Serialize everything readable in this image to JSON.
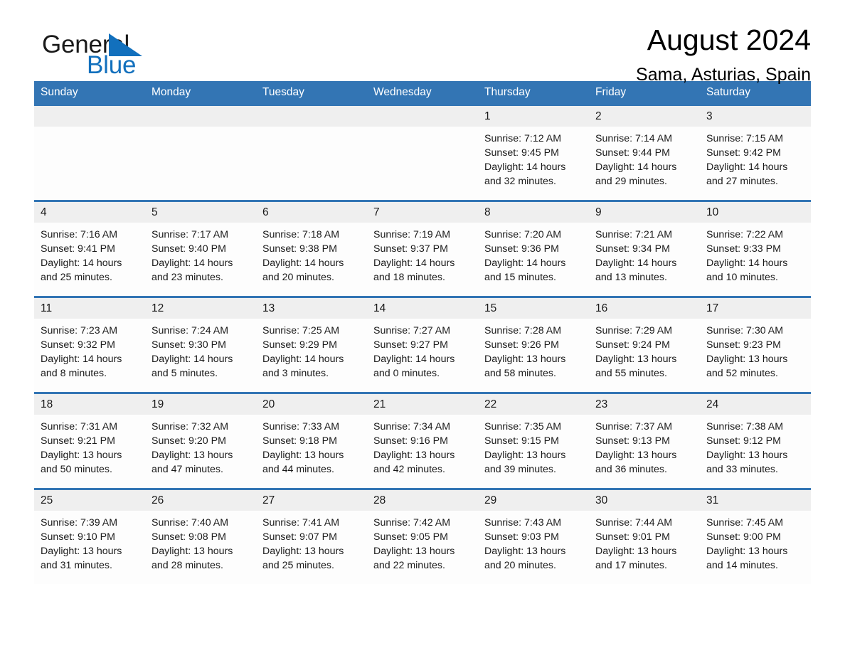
{
  "brand": {
    "name_part1": "General",
    "name_part2": "Blue",
    "flag_icon": "flag-triangle-icon",
    "accent_color": "#1270bd"
  },
  "header": {
    "title": "August 2024",
    "subtitle": "Sama, Asturias, Spain"
  },
  "calendar": {
    "header_bg": "#3375b4",
    "daynum_bg": "#efefef",
    "weekdays": [
      "Sunday",
      "Monday",
      "Tuesday",
      "Wednesday",
      "Thursday",
      "Friday",
      "Saturday"
    ],
    "labels": {
      "sunrise": "Sunrise:",
      "sunset": "Sunset:",
      "daylight": "Daylight:"
    },
    "weeks": [
      [
        {
          "day": "",
          "empty": true
        },
        {
          "day": "",
          "empty": true
        },
        {
          "day": "",
          "empty": true
        },
        {
          "day": "",
          "empty": true
        },
        {
          "day": "1",
          "sunrise": "Sunrise: 7:12 AM",
          "sunset": "Sunset: 9:45 PM",
          "daylight_1": "Daylight: 14 hours",
          "daylight_2": "and 32 minutes."
        },
        {
          "day": "2",
          "sunrise": "Sunrise: 7:14 AM",
          "sunset": "Sunset: 9:44 PM",
          "daylight_1": "Daylight: 14 hours",
          "daylight_2": "and 29 minutes."
        },
        {
          "day": "3",
          "sunrise": "Sunrise: 7:15 AM",
          "sunset": "Sunset: 9:42 PM",
          "daylight_1": "Daylight: 14 hours",
          "daylight_2": "and 27 minutes."
        }
      ],
      [
        {
          "day": "4",
          "sunrise": "Sunrise: 7:16 AM",
          "sunset": "Sunset: 9:41 PM",
          "daylight_1": "Daylight: 14 hours",
          "daylight_2": "and 25 minutes."
        },
        {
          "day": "5",
          "sunrise": "Sunrise: 7:17 AM",
          "sunset": "Sunset: 9:40 PM",
          "daylight_1": "Daylight: 14 hours",
          "daylight_2": "and 23 minutes."
        },
        {
          "day": "6",
          "sunrise": "Sunrise: 7:18 AM",
          "sunset": "Sunset: 9:38 PM",
          "daylight_1": "Daylight: 14 hours",
          "daylight_2": "and 20 minutes."
        },
        {
          "day": "7",
          "sunrise": "Sunrise: 7:19 AM",
          "sunset": "Sunset: 9:37 PM",
          "daylight_1": "Daylight: 14 hours",
          "daylight_2": "and 18 minutes."
        },
        {
          "day": "8",
          "sunrise": "Sunrise: 7:20 AM",
          "sunset": "Sunset: 9:36 PM",
          "daylight_1": "Daylight: 14 hours",
          "daylight_2": "and 15 minutes."
        },
        {
          "day": "9",
          "sunrise": "Sunrise: 7:21 AM",
          "sunset": "Sunset: 9:34 PM",
          "daylight_1": "Daylight: 14 hours",
          "daylight_2": "and 13 minutes."
        },
        {
          "day": "10",
          "sunrise": "Sunrise: 7:22 AM",
          "sunset": "Sunset: 9:33 PM",
          "daylight_1": "Daylight: 14 hours",
          "daylight_2": "and 10 minutes."
        }
      ],
      [
        {
          "day": "11",
          "sunrise": "Sunrise: 7:23 AM",
          "sunset": "Sunset: 9:32 PM",
          "daylight_1": "Daylight: 14 hours",
          "daylight_2": "and 8 minutes."
        },
        {
          "day": "12",
          "sunrise": "Sunrise: 7:24 AM",
          "sunset": "Sunset: 9:30 PM",
          "daylight_1": "Daylight: 14 hours",
          "daylight_2": "and 5 minutes."
        },
        {
          "day": "13",
          "sunrise": "Sunrise: 7:25 AM",
          "sunset": "Sunset: 9:29 PM",
          "daylight_1": "Daylight: 14 hours",
          "daylight_2": "and 3 minutes."
        },
        {
          "day": "14",
          "sunrise": "Sunrise: 7:27 AM",
          "sunset": "Sunset: 9:27 PM",
          "daylight_1": "Daylight: 14 hours",
          "daylight_2": "and 0 minutes."
        },
        {
          "day": "15",
          "sunrise": "Sunrise: 7:28 AM",
          "sunset": "Sunset: 9:26 PM",
          "daylight_1": "Daylight: 13 hours",
          "daylight_2": "and 58 minutes."
        },
        {
          "day": "16",
          "sunrise": "Sunrise: 7:29 AM",
          "sunset": "Sunset: 9:24 PM",
          "daylight_1": "Daylight: 13 hours",
          "daylight_2": "and 55 minutes."
        },
        {
          "day": "17",
          "sunrise": "Sunrise: 7:30 AM",
          "sunset": "Sunset: 9:23 PM",
          "daylight_1": "Daylight: 13 hours",
          "daylight_2": "and 52 minutes."
        }
      ],
      [
        {
          "day": "18",
          "sunrise": "Sunrise: 7:31 AM",
          "sunset": "Sunset: 9:21 PM",
          "daylight_1": "Daylight: 13 hours",
          "daylight_2": "and 50 minutes."
        },
        {
          "day": "19",
          "sunrise": "Sunrise: 7:32 AM",
          "sunset": "Sunset: 9:20 PM",
          "daylight_1": "Daylight: 13 hours",
          "daylight_2": "and 47 minutes."
        },
        {
          "day": "20",
          "sunrise": "Sunrise: 7:33 AM",
          "sunset": "Sunset: 9:18 PM",
          "daylight_1": "Daylight: 13 hours",
          "daylight_2": "and 44 minutes."
        },
        {
          "day": "21",
          "sunrise": "Sunrise: 7:34 AM",
          "sunset": "Sunset: 9:16 PM",
          "daylight_1": "Daylight: 13 hours",
          "daylight_2": "and 42 minutes."
        },
        {
          "day": "22",
          "sunrise": "Sunrise: 7:35 AM",
          "sunset": "Sunset: 9:15 PM",
          "daylight_1": "Daylight: 13 hours",
          "daylight_2": "and 39 minutes."
        },
        {
          "day": "23",
          "sunrise": "Sunrise: 7:37 AM",
          "sunset": "Sunset: 9:13 PM",
          "daylight_1": "Daylight: 13 hours",
          "daylight_2": "and 36 minutes."
        },
        {
          "day": "24",
          "sunrise": "Sunrise: 7:38 AM",
          "sunset": "Sunset: 9:12 PM",
          "daylight_1": "Daylight: 13 hours",
          "daylight_2": "and 33 minutes."
        }
      ],
      [
        {
          "day": "25",
          "sunrise": "Sunrise: 7:39 AM",
          "sunset": "Sunset: 9:10 PM",
          "daylight_1": "Daylight: 13 hours",
          "daylight_2": "and 31 minutes."
        },
        {
          "day": "26",
          "sunrise": "Sunrise: 7:40 AM",
          "sunset": "Sunset: 9:08 PM",
          "daylight_1": "Daylight: 13 hours",
          "daylight_2": "and 28 minutes."
        },
        {
          "day": "27",
          "sunrise": "Sunrise: 7:41 AM",
          "sunset": "Sunset: 9:07 PM",
          "daylight_1": "Daylight: 13 hours",
          "daylight_2": "and 25 minutes."
        },
        {
          "day": "28",
          "sunrise": "Sunrise: 7:42 AM",
          "sunset": "Sunset: 9:05 PM",
          "daylight_1": "Daylight: 13 hours",
          "daylight_2": "and 22 minutes."
        },
        {
          "day": "29",
          "sunrise": "Sunrise: 7:43 AM",
          "sunset": "Sunset: 9:03 PM",
          "daylight_1": "Daylight: 13 hours",
          "daylight_2": "and 20 minutes."
        },
        {
          "day": "30",
          "sunrise": "Sunrise: 7:44 AM",
          "sunset": "Sunset: 9:01 PM",
          "daylight_1": "Daylight: 13 hours",
          "daylight_2": "and 17 minutes."
        },
        {
          "day": "31",
          "sunrise": "Sunrise: 7:45 AM",
          "sunset": "Sunset: 9:00 PM",
          "daylight_1": "Daylight: 13 hours",
          "daylight_2": "and 14 minutes."
        }
      ]
    ]
  }
}
